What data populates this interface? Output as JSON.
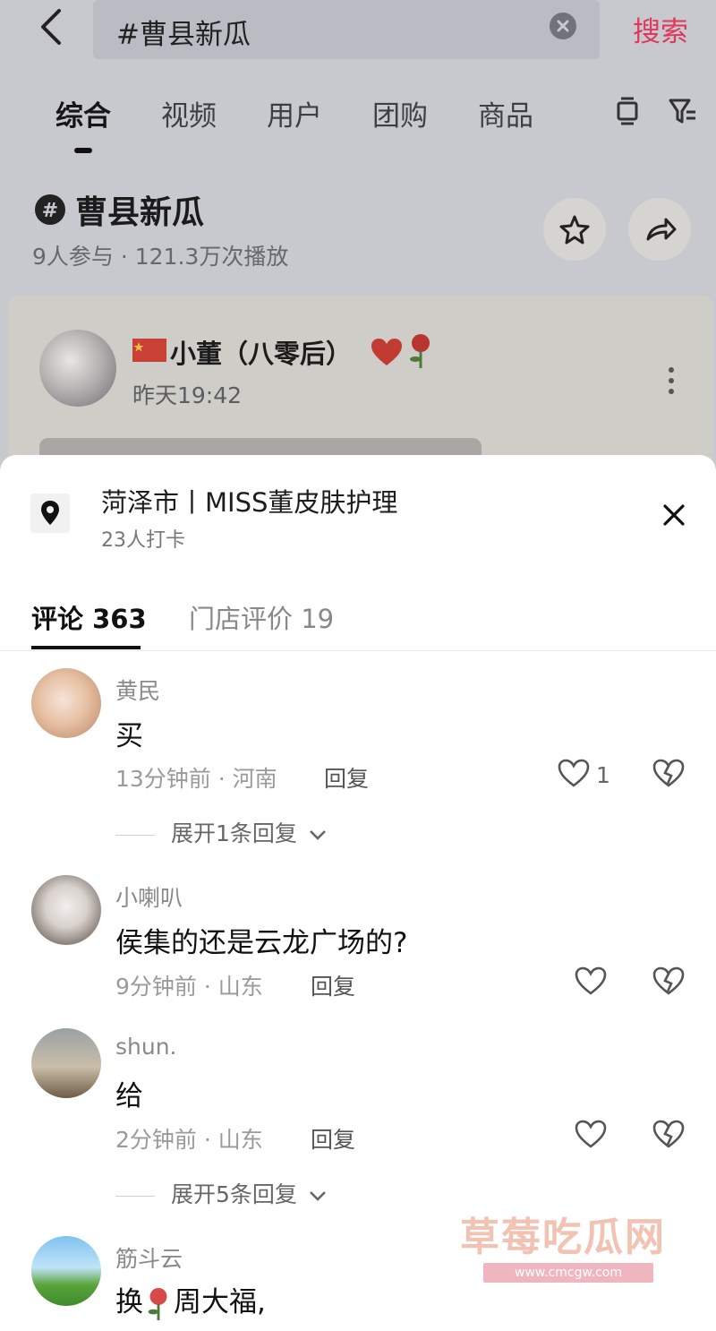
{
  "search": {
    "query": "#曹县新瓜",
    "button": "搜索"
  },
  "tabs": [
    "综合",
    "视频",
    "用户",
    "团购",
    "商品"
  ],
  "topic": {
    "title": "曹县新瓜",
    "meta": "9人参与 · 121.3万次播放"
  },
  "post": {
    "author": "小董（八零后）",
    "time": "昨天19:42"
  },
  "location": {
    "name": "菏泽市丨MISS董皮肤护理",
    "checkins": "23人打卡"
  },
  "sheet_tabs": {
    "comments": "评论 363",
    "reviews": "门店评价 19"
  },
  "comments": [
    {
      "user": "黄民",
      "text": "买",
      "meta": "13分钟前 · 河南",
      "reply": "回复",
      "likes": "1",
      "expand": "展开1条回复"
    },
    {
      "user": "小喇叭",
      "text": "侯集的还是云龙广场的?",
      "meta": "9分钟前 · 山东",
      "reply": "回复"
    },
    {
      "user": "shun.",
      "text": "给",
      "meta": "2分钟前 · 山东",
      "reply": "回复",
      "expand": "展开5条回复"
    },
    {
      "user": "筋斗云",
      "text_before": "换",
      "text_after": "周大福,"
    }
  ],
  "watermark": {
    "text": "草莓吃瓜网",
    "url": "www.cmcgw.com"
  },
  "colors": {
    "accent": "#e1375a",
    "overlay": "#c7c9ce",
    "sheet": "#ffffff"
  }
}
